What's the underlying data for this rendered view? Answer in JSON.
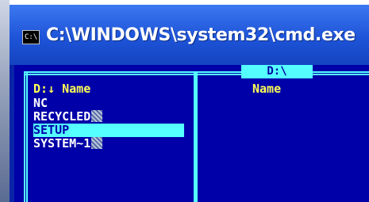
{
  "window": {
    "title": "C:\\WINDOWS\\system32\\cmd.exe",
    "icon_label": "C:\\"
  },
  "panel": {
    "path_tag": "D:\\",
    "left_header": "D:↓ Name",
    "right_header": "Name",
    "files": [
      {
        "name": "NC",
        "selected": false,
        "hidden_marker": false
      },
      {
        "name": "RECYCLED",
        "selected": false,
        "hidden_marker": true
      },
      {
        "name": "SETUP",
        "selected": true,
        "hidden_marker": false
      },
      {
        "name": "SYSTEM~1",
        "selected": false,
        "hidden_marker": true
      }
    ]
  },
  "colors": {
    "console_bg": "#0000a8",
    "frame": "#55ffff",
    "header_text": "#ffff55",
    "file_text": "#ffffff",
    "selection_bg": "#55ffff",
    "titlebar": "#1e54d8"
  }
}
